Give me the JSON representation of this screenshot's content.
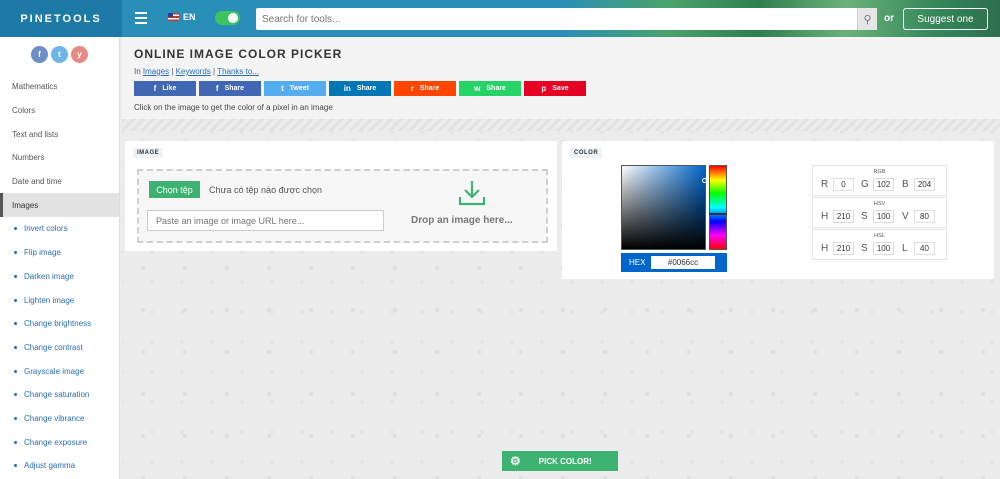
{
  "header": {
    "logo": "PINETOOLS",
    "language": "EN",
    "search_placeholder": "Search for tools...",
    "or_text": "or",
    "suggest_label": "Suggest one"
  },
  "sidebar": {
    "socials": [
      "f",
      "t",
      "y"
    ],
    "items": [
      "Mathematics",
      "Colors",
      "Text and lists",
      "Numbers",
      "Date and time",
      "Images"
    ],
    "active_item": "Images",
    "sub_items": [
      "Invert colors",
      "Flip image",
      "Darken image",
      "Lighten image",
      "Change brightness",
      "Change contrast",
      "Grayscale image",
      "Change saturation",
      "Change vibrance",
      "Change exposure",
      "Adjust gamma"
    ]
  },
  "page": {
    "title": "ONLINE IMAGE COLOR PICKER",
    "breadcrumb_in": "In",
    "breadcrumb_links": [
      "Images",
      "Keywords",
      "Thanks to..."
    ],
    "instruction": "Click on the image to get the color of a pixel in an image"
  },
  "share": [
    {
      "icon": "f",
      "label": "Like",
      "color": "#4267b2"
    },
    {
      "icon": "f",
      "label": "Share",
      "color": "#4267b2"
    },
    {
      "icon": "t",
      "label": "Tweet",
      "color": "#55acee"
    },
    {
      "icon": "in",
      "label": "Share",
      "color": "#0077b5"
    },
    {
      "icon": "r",
      "label": "Share",
      "color": "#ff4500"
    },
    {
      "icon": "w",
      "label": "Share",
      "color": "#25d366"
    },
    {
      "icon": "p",
      "label": "Save",
      "color": "#e60023"
    }
  ],
  "image_panel": {
    "label": "IMAGE",
    "choose_button": "Chọn tệp",
    "no_file_text": "Chưa có tệp nào được chọn",
    "url_placeholder": "Paste an image or image URL here...",
    "drop_text": "Drop an image here..."
  },
  "color_panel": {
    "label": "COLOR",
    "hex_label": "HEX",
    "hex_value": "#0066cc",
    "color": "#0066cc",
    "models": [
      {
        "name": "RGB",
        "channels": [
          {
            "l": "R",
            "v": "0"
          },
          {
            "l": "G",
            "v": "102"
          },
          {
            "l": "B",
            "v": "204"
          }
        ]
      },
      {
        "name": "HSV",
        "channels": [
          {
            "l": "H",
            "v": "210"
          },
          {
            "l": "S",
            "v": "100"
          },
          {
            "l": "V",
            "v": "80"
          }
        ]
      },
      {
        "name": "HSL",
        "channels": [
          {
            "l": "H",
            "v": "210"
          },
          {
            "l": "S",
            "v": "100"
          },
          {
            "l": "L",
            "v": "40"
          }
        ]
      }
    ]
  },
  "pick_button": "PICK COLOR!"
}
